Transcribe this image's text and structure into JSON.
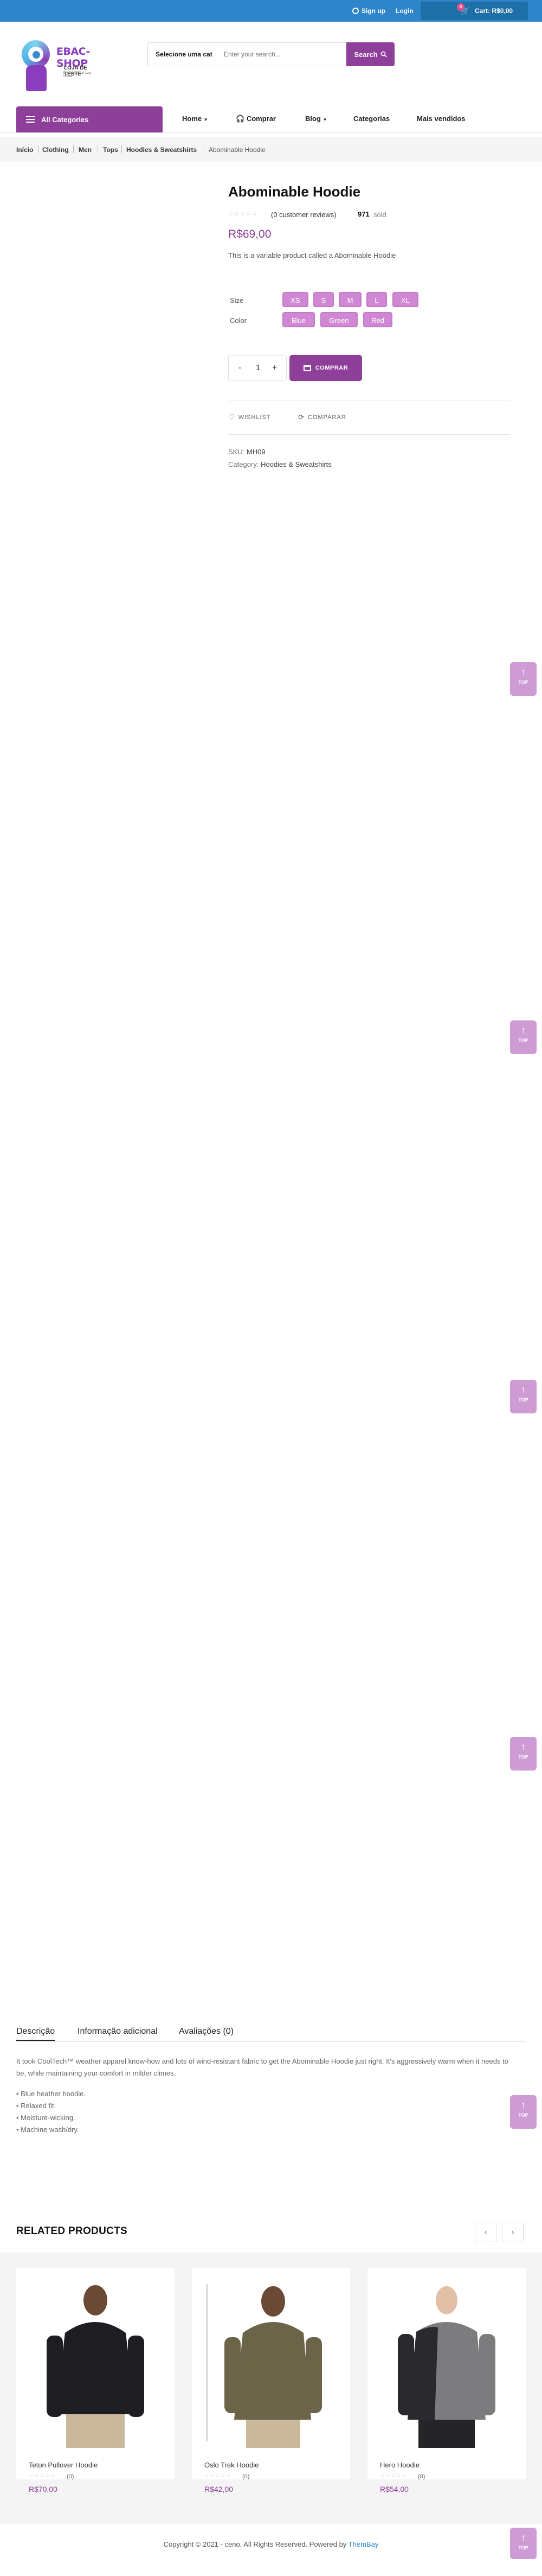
{
  "topbar": {
    "signup": "Sign up",
    "login": "Login",
    "wishlist_count": "0",
    "cart_count": "0",
    "cart_label": "Cart",
    "cart_total": "R$0,00"
  },
  "logo": {
    "name": "EBAC-SHOP",
    "tagline": "LOJA DE TESTE",
    "small": "Simulações de Loja Virtual"
  },
  "search": {
    "category": "Selecione uma cat",
    "placeholder": "Enter your search...",
    "button": "Search"
  },
  "nav": {
    "all_categories": "All Categories",
    "items": [
      "Home",
      "Comprar",
      "Blog",
      "Categorias",
      "Mais vendidos"
    ]
  },
  "breadcrumb": [
    "Início",
    "Clothing",
    "Men",
    "Tops",
    "Hoodies & Sweatshirts",
    "Abominable Hoodie"
  ],
  "product": {
    "title": "Abominable Hoodie",
    "reviews": "(0 customer reviews)",
    "sold_count": "971",
    "sold_label": "sold",
    "price": "R$69,00",
    "short_description": "This is a variable product called a Abominable Hoodie",
    "size_label": "Size",
    "sizes": [
      "XS",
      "S",
      "M",
      "L",
      "XL"
    ],
    "color_label": "Color",
    "colors": [
      "Blue",
      "Green",
      "Red"
    ],
    "qty_minus": "-",
    "qty_value": "1",
    "qty_plus": "+",
    "buy_label": "COMPRAR",
    "wishlist": "WISHLIST",
    "compare": "COMPARAR",
    "sku_label": "SKU:",
    "sku": "MH09",
    "category_label": "Category:",
    "category": "Hoodies & Sweatshirts"
  },
  "to_top_label": "TOP",
  "tabs": [
    "Descrição",
    "Informação adicional",
    "Avaliações (0)"
  ],
  "description": {
    "text": "It took CoolTech™ weather apparel know-how and lots of wind-resistant fabric to get the Abominable Hoodie just right. It's aggressively warm when it needs to be, while maintaining your comfort in milder climes.",
    "bullets": [
      "• Blue heather hoodie.",
      "• Relaxed fit.",
      "• Moisture-wicking.",
      "• Machine wash/dry."
    ]
  },
  "related": {
    "title": "RELATED PRODUCTS",
    "prev": "‹",
    "next": "›",
    "items": [
      {
        "name": "Teton Pullover Hoodie",
        "count": "(0)",
        "price": "R$70,00",
        "color": "#1e1e22"
      },
      {
        "name": "Oslo Trek Hoodie",
        "count": "(0)",
        "price": "R$42,00",
        "color": "#6b6448"
      },
      {
        "name": "Hero Hoodie",
        "count": "(0)",
        "price": "R$54,00",
        "color": "#7c7c7e"
      }
    ]
  },
  "footer": {
    "text": "Copyright © 2021 - ceno. All Rights Reserved. Powered by",
    "brand": "ThemBay"
  },
  "colors": {
    "primary": "#8e3f9a",
    "topbar": "#2f85c9",
    "variant": "#d188d4"
  }
}
